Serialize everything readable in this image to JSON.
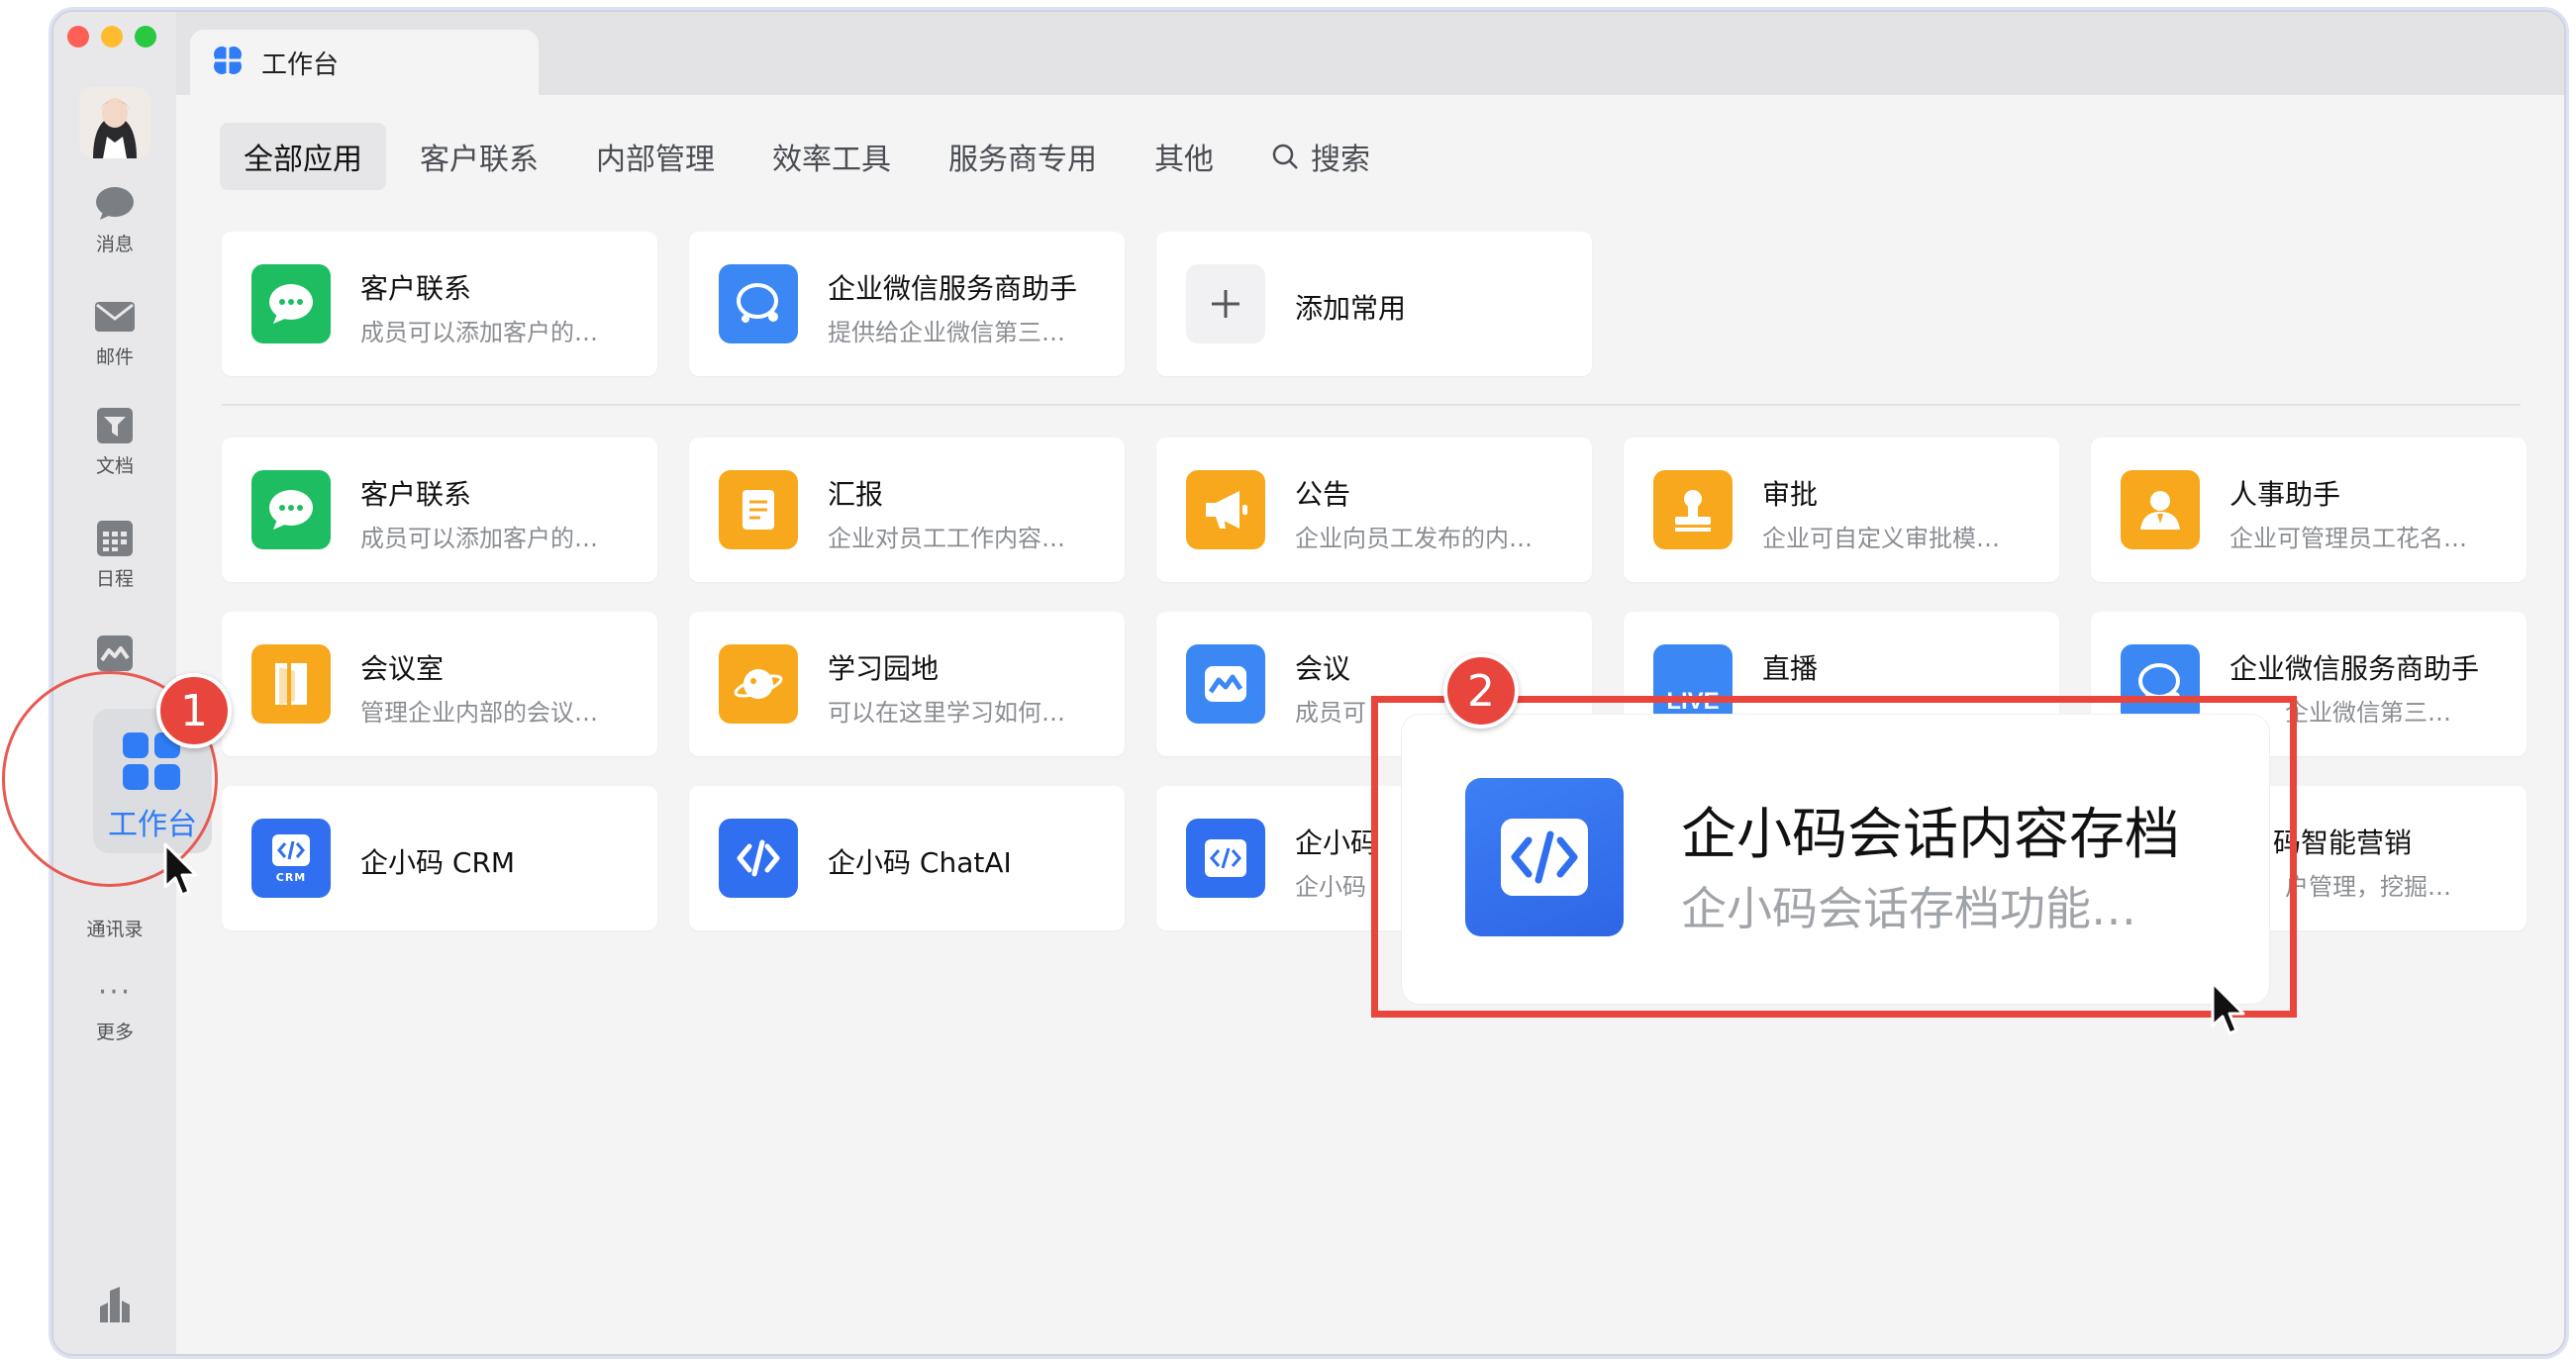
{
  "window": {
    "tab_title": "工作台"
  },
  "sidebar": {
    "items": [
      {
        "label": "消息",
        "icon": "chat-bubble-icon"
      },
      {
        "label": "邮件",
        "icon": "mail-icon"
      },
      {
        "label": "文档",
        "icon": "document-icon"
      },
      {
        "label": "日程",
        "icon": "calendar-icon"
      },
      {
        "label": "工作台",
        "icon": "grid-icon",
        "active": true
      },
      {
        "label": "通讯录",
        "icon": "contacts-icon"
      },
      {
        "label": "更多",
        "icon": "more-icon"
      }
    ],
    "more_glyph": "···"
  },
  "categories": [
    {
      "label": "全部应用",
      "active": true
    },
    {
      "label": "客户联系"
    },
    {
      "label": "内部管理"
    },
    {
      "label": "效率工具"
    },
    {
      "label": "服务商专用"
    },
    {
      "label": "其他"
    },
    {
      "label": "搜索",
      "icon": "search-icon"
    }
  ],
  "favorites": [
    {
      "title": "客户联系",
      "subtitle": "成员可以添加客户的…",
      "icon": "chat-icon",
      "color": "#1fbd62"
    },
    {
      "title": "企业微信服务商助手",
      "subtitle": "提供给企业微信第三…",
      "icon": "service-helper-icon",
      "color": "#3b88f5"
    },
    {
      "title": "添加常用",
      "icon": "plus-icon"
    }
  ],
  "apps": [
    {
      "title": "客户联系",
      "subtitle": "成员可以添加客户的…",
      "icon": "chat-icon",
      "color": "#1fbd62"
    },
    {
      "title": "汇报",
      "subtitle": "企业对员工工作内容…",
      "icon": "report-icon",
      "color": "#f7a81c"
    },
    {
      "title": "公告",
      "subtitle": "企业向员工发布的内…",
      "icon": "megaphone-icon",
      "color": "#f7a81c"
    },
    {
      "title": "审批",
      "subtitle": "企业可自定义审批模…",
      "icon": "stamp-icon",
      "color": "#f7a81c"
    },
    {
      "title": "人事助手",
      "subtitle": "企业可管理员工花名…",
      "icon": "person-icon",
      "color": "#f7a81c"
    },
    {
      "title": "会议室",
      "subtitle": "管理企业内部的会议…",
      "icon": "door-icon",
      "color": "#f7a81c"
    },
    {
      "title": "学习园地",
      "subtitle": "可以在这里学习如何…",
      "icon": "planet-icon",
      "color": "#f7a81c"
    },
    {
      "title": "会议",
      "subtitle": "成员可",
      "icon": "meeting-icon",
      "color": "#3b88f5"
    },
    {
      "title": "直播",
      "subtitle": "",
      "icon": "live-icon",
      "color": "#3b88f5",
      "badge_text": "LIVE"
    },
    {
      "title": "企业微信服务商助手",
      "subtitle": "企业微信第三…",
      "icon": "service-helper-icon",
      "color": "#3b88f5"
    },
    {
      "title": "企小码 CRM",
      "subtitle": "",
      "icon": "code-crm-icon",
      "color": "#2f6ff0",
      "badge_text": "CRM"
    },
    {
      "title": "企小码 ChatAI",
      "subtitle": "",
      "icon": "code-icon",
      "color": "#2f6ff0"
    },
    {
      "title": "企小码",
      "subtitle": "企小码",
      "icon": "code-icon",
      "color": "#2f6ff0"
    },
    {
      "title": "码智能营销",
      "subtitle": "户管理，挖掘…",
      "icon": "code-icon",
      "color": "#2f6ff0"
    }
  ],
  "popup": {
    "title": "企小码会话内容存档",
    "subtitle": "企小码会话存档功能…"
  },
  "annotations": {
    "step1": "1",
    "step2": "2"
  }
}
